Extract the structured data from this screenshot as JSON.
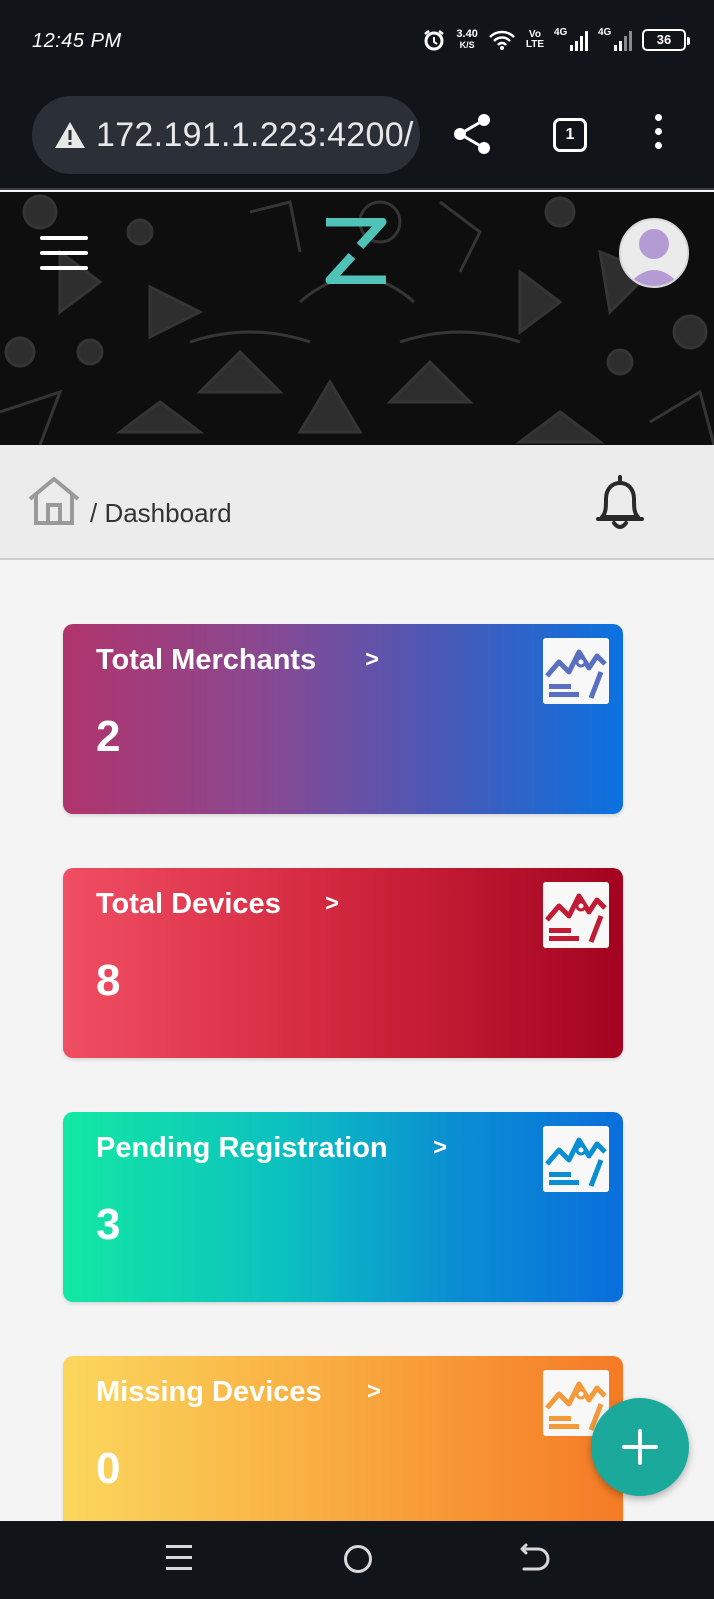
{
  "status": {
    "time": "12:45 PM",
    "speed_value": "3.40",
    "speed_unit": "K/S",
    "volte_top": "Vo",
    "volte_bottom": "LTE",
    "net1": "4G",
    "net2": "4G",
    "battery": "36"
  },
  "browser": {
    "url": "172.191.1.223:4200/",
    "tab_count": "1"
  },
  "breadcrumb": {
    "text": "/ Dashboard"
  },
  "cards": [
    {
      "title": "Total Merchants",
      "value": "2",
      "chevron": ">"
    },
    {
      "title": "Total Devices",
      "value": "8",
      "chevron": ">"
    },
    {
      "title": "Pending Registration",
      "value": "3",
      "chevron": ">"
    },
    {
      "title": "Missing Devices",
      "value": "0",
      "chevron": ">"
    }
  ],
  "colors": {
    "accent_teal": "#1aa99a",
    "logo_teal": "#4fc3b8",
    "card1_start": "#b0346c",
    "card1_end": "#0a72e0",
    "card2_start": "#f04e64",
    "card2_end": "#a30320",
    "card3_start": "#13e8a2",
    "card3_end": "#0a6edc",
    "card4_start": "#fbd75e",
    "card4_end": "#f57a26"
  }
}
